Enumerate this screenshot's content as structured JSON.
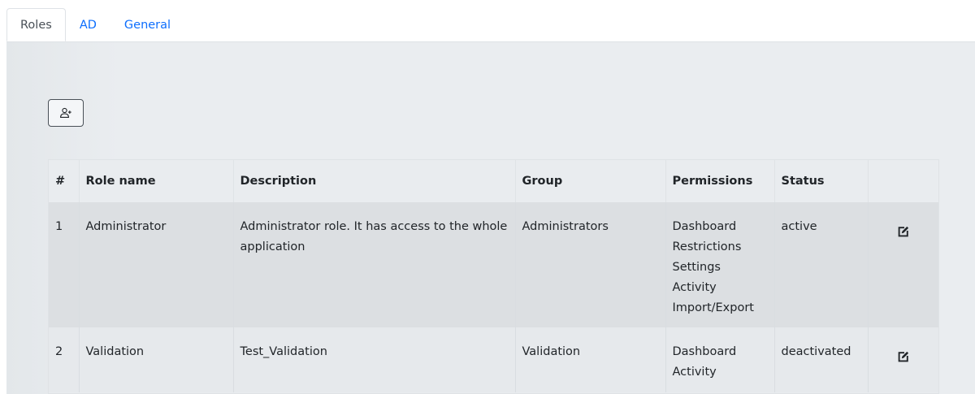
{
  "tabs": [
    {
      "label": "Roles",
      "active": true
    },
    {
      "label": "AD",
      "active": false
    },
    {
      "label": "General",
      "active": false
    }
  ],
  "toolbar": {
    "add_icon": "person-plus-icon"
  },
  "table": {
    "headers": {
      "index": "#",
      "role_name": "Role name",
      "description": "Description",
      "group": "Group",
      "permissions": "Permissions",
      "status": "Status",
      "actions": ""
    },
    "rows": [
      {
        "index": "1",
        "role_name": "Administrator",
        "description": "Administrator role. It has access to the whole application",
        "group": "Administrators",
        "permissions": [
          "Dashboard",
          "Restrictions",
          "Settings",
          "Activity",
          "Import/Export"
        ],
        "status": "active",
        "action_icon": "edit-icon"
      },
      {
        "index": "2",
        "role_name": "Validation",
        "description": "Test_Validation",
        "group": "Validation",
        "permissions": [
          "Dashboard",
          "Activity"
        ],
        "status": "deactivated",
        "action_icon": "edit-icon"
      }
    ]
  },
  "colors": {
    "link": "#0d6efd",
    "panel_bg": "#eaedf0",
    "text": "#212529"
  }
}
